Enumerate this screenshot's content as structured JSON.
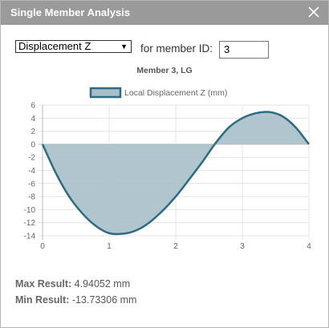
{
  "window": {
    "title": "Single Member Analysis"
  },
  "controls": {
    "select_value": "Displacement Z",
    "member_label": "for member ID:",
    "member_id": "3"
  },
  "chart_data": {
    "type": "area",
    "title": "Member 3, LG",
    "legend": "Local Displacement Z (mm)",
    "series": [
      {
        "name": "Local Displacement Z (mm)",
        "x": [
          0,
          0.2,
          0.4,
          0.6,
          0.8,
          1.0,
          1.2,
          1.4,
          1.6,
          1.8,
          2.0,
          2.2,
          2.4,
          2.6,
          2.8,
          3.0,
          3.2,
          3.4,
          3.6,
          3.8,
          4.0
        ],
        "values": [
          0,
          -4.4,
          -8.0,
          -10.6,
          -12.5,
          -13.6,
          -13.7,
          -13.2,
          -12.0,
          -10.2,
          -8.0,
          -5.4,
          -2.7,
          0.2,
          2.6,
          4.0,
          4.75,
          4.94,
          4.3,
          2.6,
          0
        ]
      }
    ],
    "xlim": [
      0,
      4
    ],
    "ylim": [
      -14,
      6
    ],
    "xticks": [
      0,
      1,
      2,
      3,
      4
    ],
    "yticks": [
      6,
      4,
      2,
      0,
      -2,
      -4,
      -6,
      -8,
      -10,
      -12,
      -14
    ],
    "grid": true,
    "legend_position": "top-center",
    "colors": {
      "line": "#2e6b82",
      "fill": "#a7bfc9"
    }
  },
  "summary": {
    "max_label": "Max Result:",
    "max_value": "4.94052 mm",
    "min_label": "Min Result:",
    "min_value": "-13.73306 mm"
  }
}
